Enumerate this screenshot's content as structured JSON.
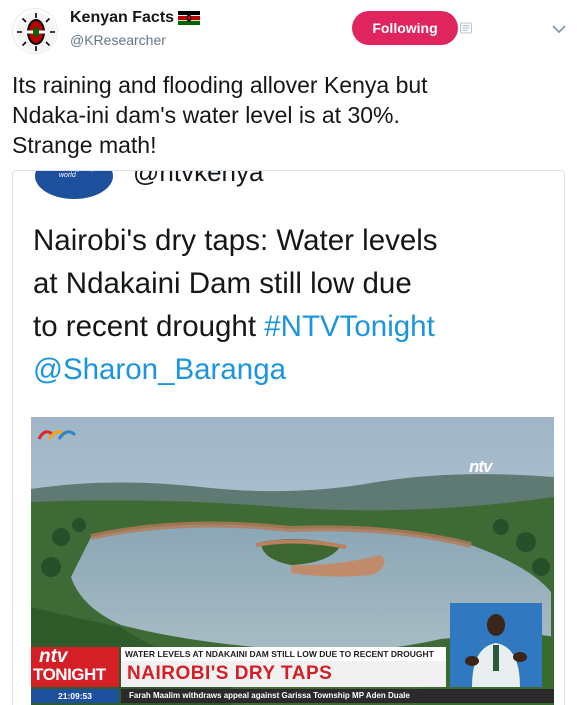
{
  "account": {
    "display_name": "Kenyan Facts",
    "handle": "@KResearcher",
    "follow_label": "Following"
  },
  "tweet": {
    "lines": [
      "Its raining and flooding allover Kenya but",
      "Ndaka-ini dam's water level is at 30%.",
      "Strange math!"
    ]
  },
  "embedded": {
    "cut_handle": "@ntvkenya",
    "logo_tagline": "turning on your world",
    "text_lines": [
      {
        "plain": "Nairobi's dry taps: Water levels",
        "link": ""
      },
      {
        "plain": "at Ndakaini Dam still low due",
        "link": ""
      },
      {
        "plain": "to recent drought ",
        "link": "#NTVTonight"
      },
      {
        "plain": "",
        "link": "@Sharon_Baranga"
      }
    ],
    "watermark": "ntv",
    "lower_third": {
      "logo_top": "ntv",
      "logo_bottom": "TONIGHT",
      "subheadline": "WATER LEVELS AT NDAKAINI DAM STILL LOW DUE TO RECENT DROUGHT",
      "headline": "NAIROBI'S DRY TAPS",
      "time": "21:09:53",
      "ticker": "Farah Maalim withdraws appeal against Garissa Township MP Aden Duale"
    }
  },
  "colors": {
    "follow_button": "#e0245e",
    "link": "#1b95e0",
    "ntv_red": "#d41f26",
    "ntv_blue": "#1c4f9c"
  },
  "icons": [
    "kenya-flag-icon",
    "notifications-muted-icon",
    "chevron-down-icon"
  ]
}
